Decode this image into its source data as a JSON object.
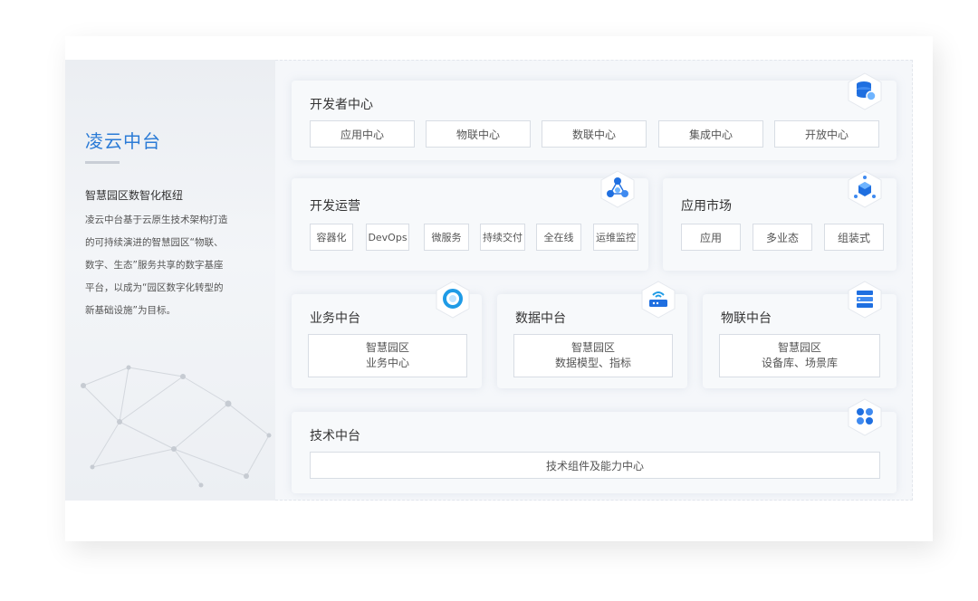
{
  "sidebar": {
    "title": "凌云中台",
    "subtitle": "智慧园区数智化枢纽",
    "desc_lines": [
      "凌云中台基于云原生技术架构打造",
      "的可持续演进的智慧园区“物联、",
      "数字、生态”服务共享的数字基座",
      "平台，以成为“园区数字化转型的",
      "新基础设施”为目标。"
    ]
  },
  "developer_center": {
    "title": "开发者中心",
    "icon": "database-shield-icon",
    "items": [
      "应用中心",
      "物联中心",
      "数联中心",
      "集成中心",
      "开放中心"
    ]
  },
  "devops": {
    "title": "开发运营",
    "icon": "node-network-icon",
    "items": [
      "容器化",
      "DevOps",
      "微服务",
      "持续交付",
      "全在线",
      "运维监控"
    ]
  },
  "app_market": {
    "title": "应用市场",
    "icon": "cube-nodes-icon",
    "items": [
      "应用",
      "多业态",
      "组装式"
    ]
  },
  "business_platform": {
    "title": "业务中台",
    "icon": "ring-icon",
    "box_line1": "智慧园区",
    "box_line2": "业务中心"
  },
  "data_platform": {
    "title": "数据中台",
    "icon": "router-icon",
    "box_line1": "智慧园区",
    "box_line2": "数据模型、指标"
  },
  "iot_platform": {
    "title": "物联中台",
    "icon": "server-icon",
    "box_line1": "智慧园区",
    "box_line2": "设备库、场景库"
  },
  "tech_platform": {
    "title": "技术中台",
    "icon": "four-petal-icon",
    "box": "技术组件及能力中心"
  },
  "colors": {
    "accent": "#2b7bd6",
    "icon_blue": "#1f6fe0"
  }
}
